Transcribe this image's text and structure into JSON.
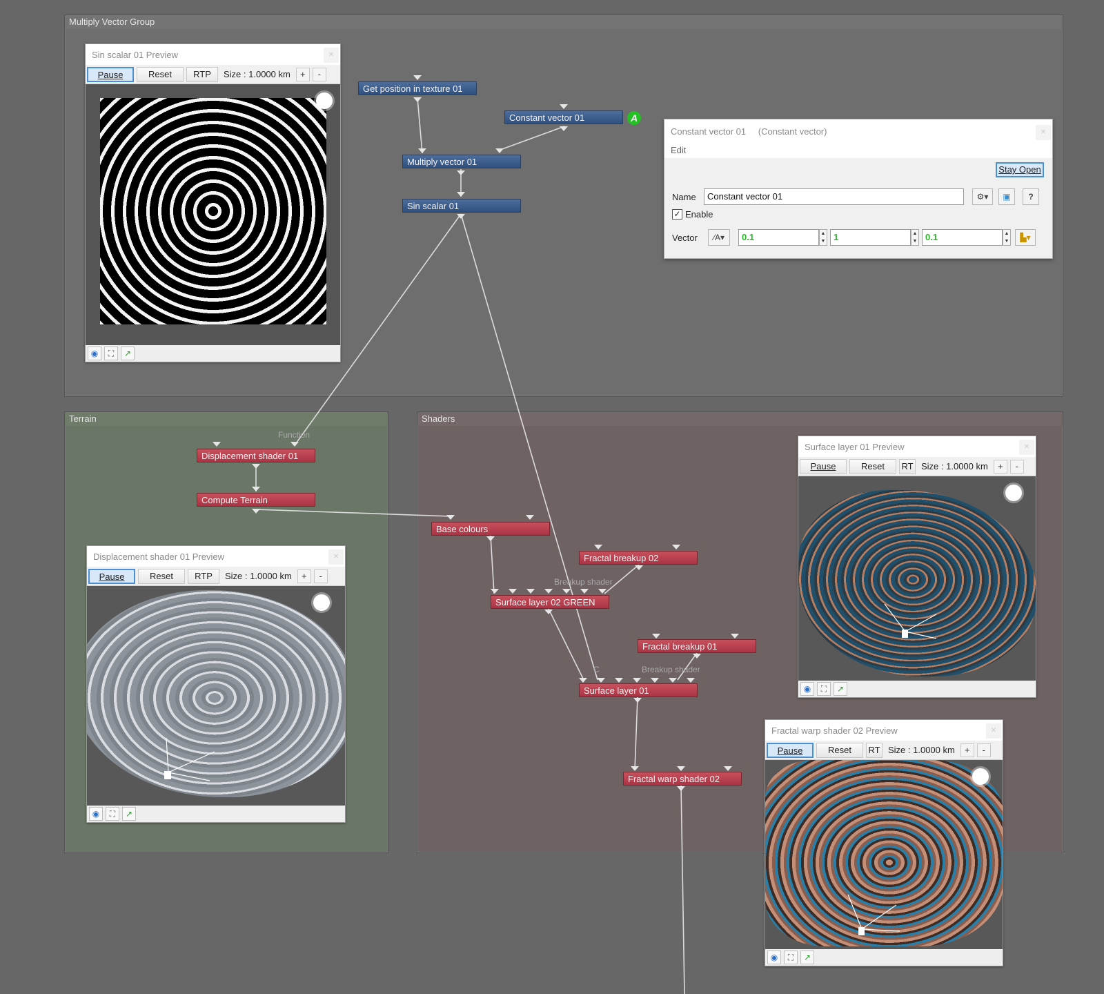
{
  "groups": {
    "multiply": "Multiply Vector Group",
    "terrain": "Terrain",
    "shaders": "Shaders"
  },
  "nodes": {
    "get_position": "Get position in texture 01",
    "constant_vector": "Constant vector 01",
    "multiply_vector": "Multiply vector 01",
    "sin_scalar": "Sin scalar 01",
    "displacement_shader": "Displacement shader 01",
    "compute_terrain": "Compute Terrain",
    "base_colours": "Base colours",
    "fractal_breakup_02": "Fractal breakup 02",
    "surface_layer_02": "Surface layer 02 GREEN",
    "fractal_breakup_01": "Fractal breakup 01",
    "surface_layer_01": "Surface layer 01",
    "fractal_warp_02": "Fractal warp shader 02"
  },
  "sublabels": {
    "function": "Function",
    "breakup_shader_a": "Breakup shader",
    "breakup_shader_b": "Breakup shader",
    "c": "C"
  },
  "animated_badge": "A",
  "previews": {
    "sin": {
      "title": "Sin scalar 01 Preview",
      "pause": "Pause",
      "reset": "Reset",
      "rtp": "RTP",
      "size": "Size : 1.0000 km",
      "plus": "+",
      "minus": "-"
    },
    "displacement": {
      "title": "Displacement shader 01 Preview",
      "pause": "Pause",
      "reset": "Reset",
      "rtp": "RTP",
      "size": "Size : 1.0000 km",
      "plus": "+",
      "minus": "-"
    },
    "surface": {
      "title": "Surface layer 01 Preview",
      "pause": "Pause",
      "reset": "Reset",
      "rtp": "RT",
      "size": "Size : 1.0000 km",
      "plus": "+",
      "minus": "-"
    },
    "fractal": {
      "title": "Fractal warp shader 02 Preview",
      "pause": "Pause",
      "reset": "Reset",
      "rtp": "RT",
      "size": "Size : 1.0000 km",
      "plus": "+",
      "minus": "-"
    }
  },
  "params": {
    "title": "Constant vector 01",
    "type": "(Constant vector)",
    "menu": "Edit",
    "stay_open": "Stay Open",
    "name_label": "Name",
    "name_value": "Constant vector 01",
    "enable_label": "Enable",
    "enabled": true,
    "vector_label": "Vector",
    "vector": [
      "0.1",
      "1",
      "0.1"
    ],
    "help": "?"
  },
  "colors": {
    "blue_node": "#3b5b8c",
    "red_node": "#b8404f",
    "accent": "#4a8fd6",
    "value_green": "#2bb52b"
  },
  "icons": {
    "eye": "eye-icon",
    "frame": "frame-icon",
    "camera_path": "camera-path-icon",
    "sun": "sun-light-icon",
    "gear": "gear-icon",
    "help": "help-icon"
  }
}
